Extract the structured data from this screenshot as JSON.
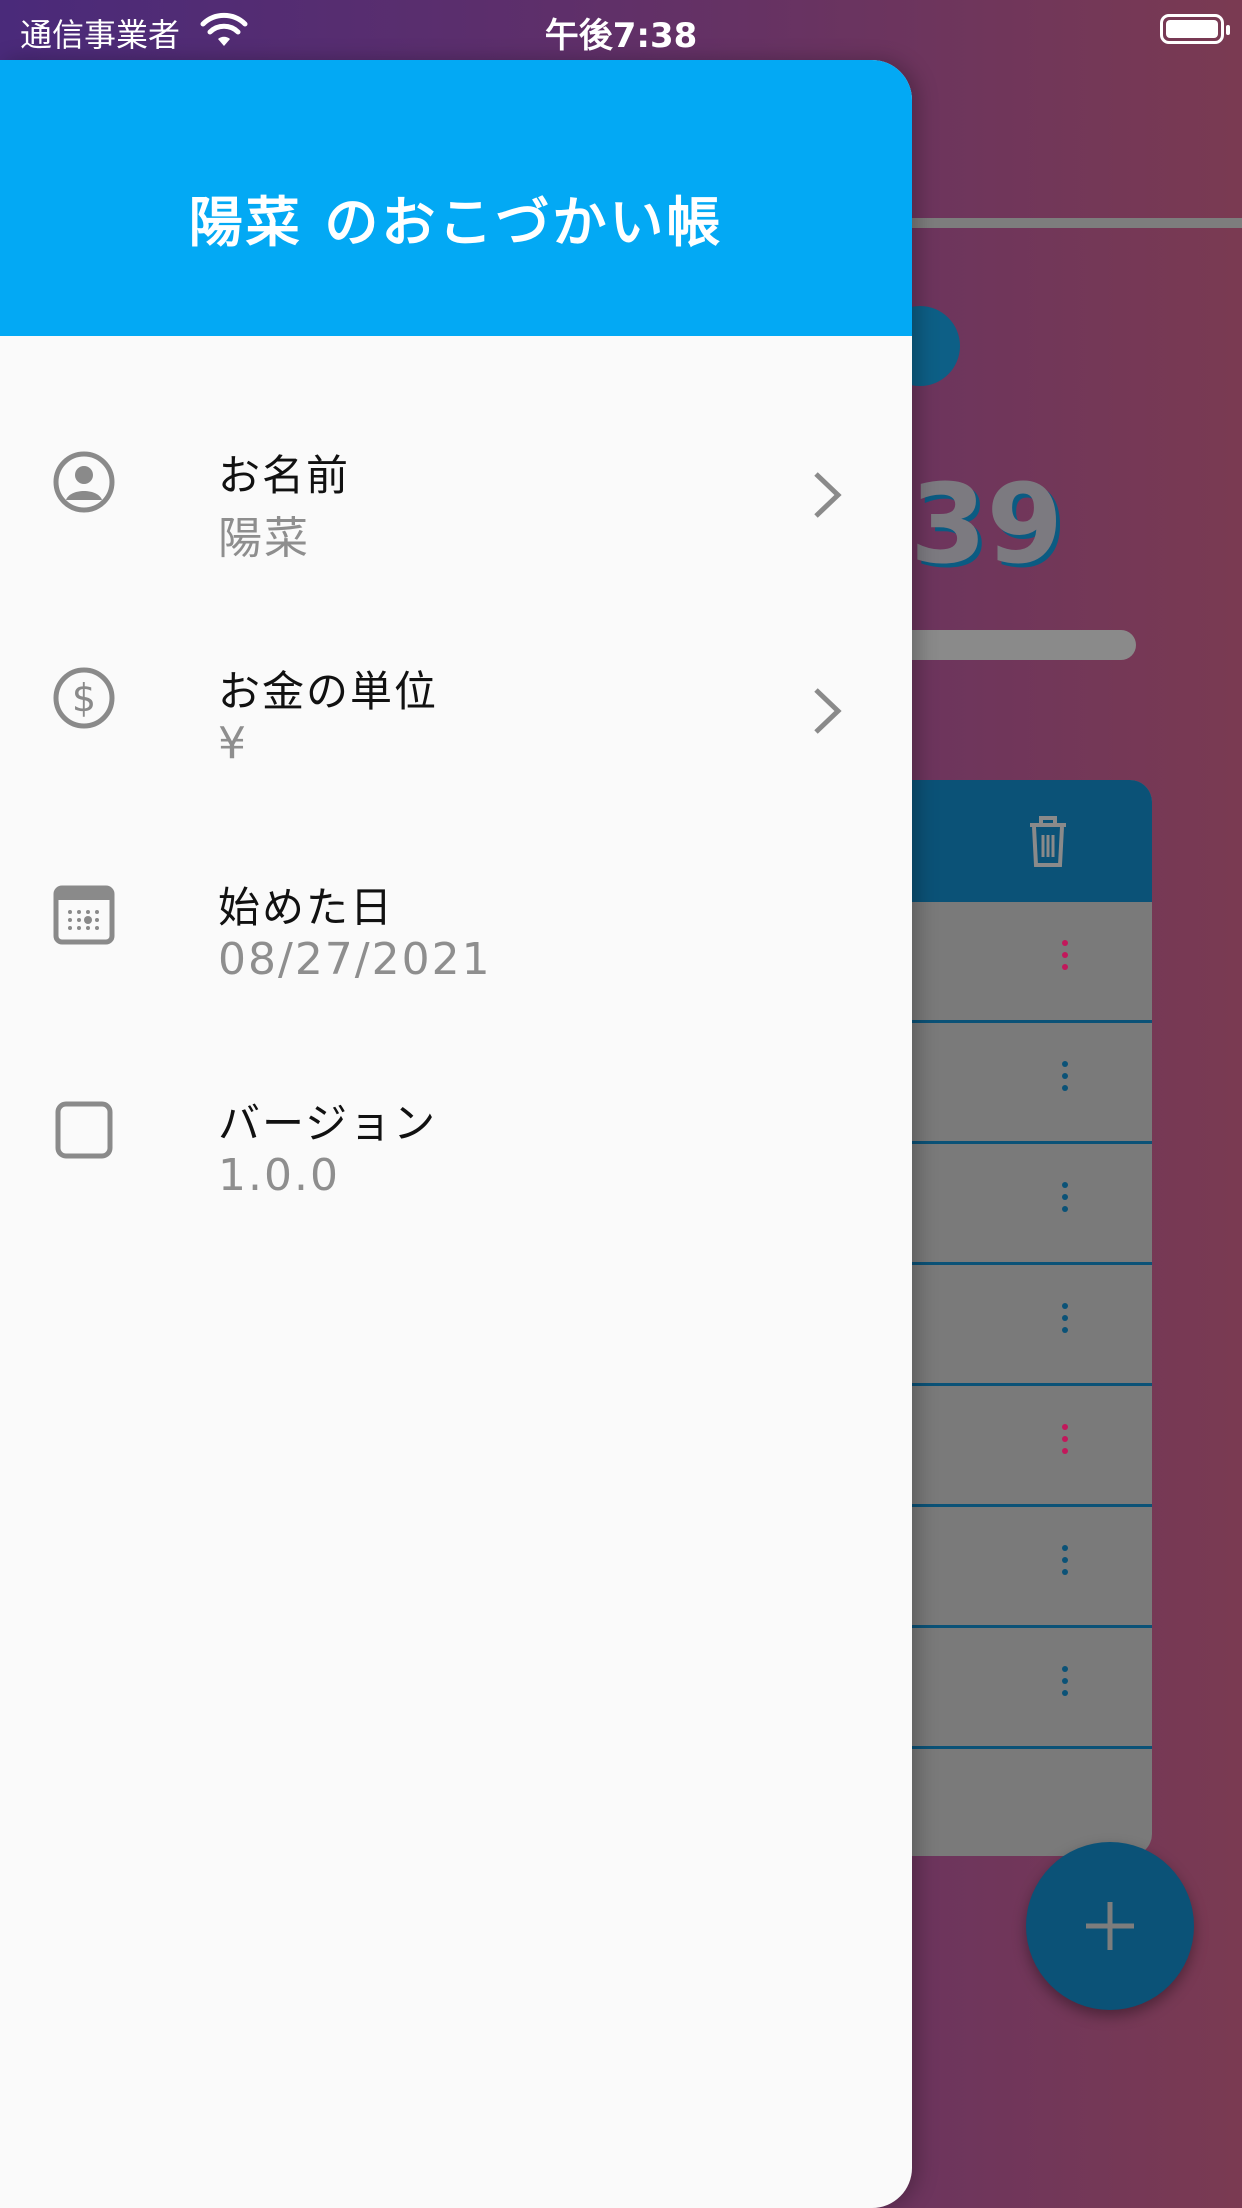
{
  "status_bar": {
    "carrier": "通信事業者",
    "time": "午後7:38"
  },
  "drawer": {
    "title": "陽菜 のおこづかい帳",
    "items": [
      {
        "label": "お名前",
        "value": "陽菜",
        "icon": "account-circle-icon",
        "has_chevron": true
      },
      {
        "label": "お金の単位",
        "value": "¥",
        "icon": "dollar-circle-icon",
        "has_chevron": true
      },
      {
        "label": "始めた日",
        "value": "08/27/2021",
        "icon": "calendar-icon",
        "has_chevron": false
      },
      {
        "label": "バージョン",
        "value": "1.0.0",
        "icon": "checkbox-outline-icon",
        "has_chevron": false
      }
    ]
  },
  "background": {
    "balance_fragment": "39",
    "row_dot_colors": [
      "#c2185b",
      "#0b5277",
      "#0b5277",
      "#0b5277",
      "#c2185b",
      "#0b5277",
      "#0b5277"
    ]
  },
  "colors": {
    "drawer_header": "#03a9f4",
    "drawer_background": "#fafafa",
    "accent_dark": "#0b5277",
    "icon_gray": "#8a8a8a"
  }
}
